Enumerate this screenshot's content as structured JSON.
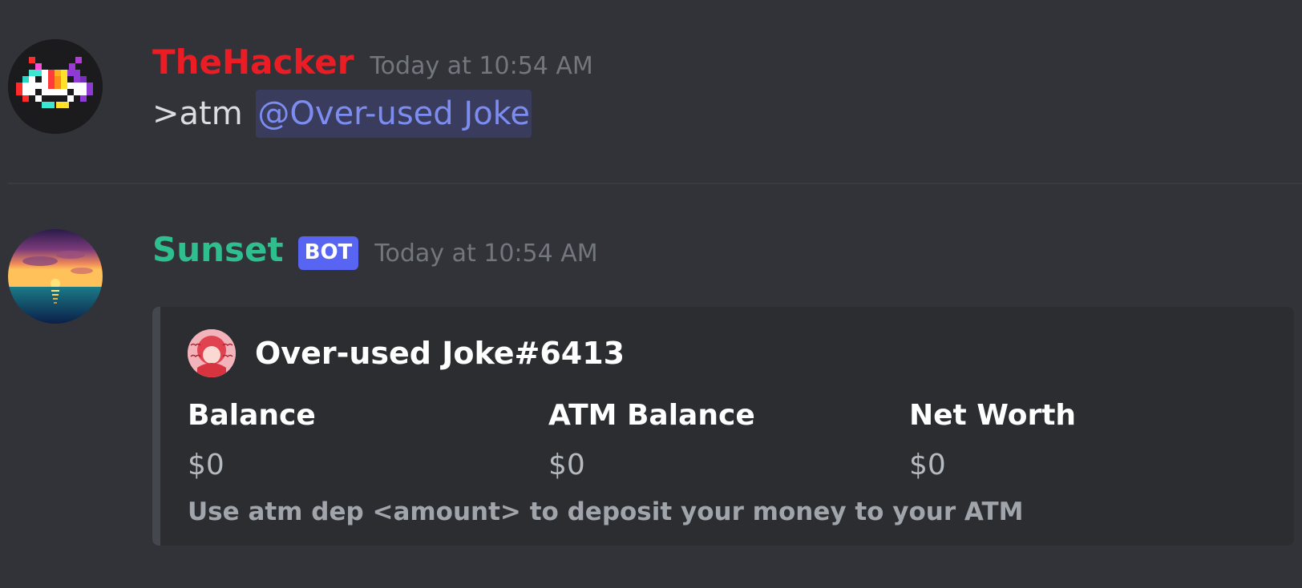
{
  "messages": [
    {
      "author": "TheHacker",
      "author_color": "#ec1c24",
      "timestamp": "Today at 10:54 AM",
      "content_prefix": ">atm",
      "mention": "@Over-used Joke",
      "avatar_icon": "pixel-space-invader-icon"
    },
    {
      "author": "Sunset",
      "author_color": "#2fbf8f",
      "bot_tag": "BOT",
      "timestamp": "Today at 10:54 AM",
      "avatar_icon": "sunset-avatar-icon",
      "embed": {
        "author": "Over-used Joke#6413",
        "author_avatar_icon": "anime-avatar-icon",
        "fields": [
          {
            "name": "Balance",
            "value": "$0"
          },
          {
            "name": "ATM Balance",
            "value": "$0"
          },
          {
            "name": "Net Worth",
            "value": "$0"
          }
        ],
        "footer": "Use atm dep <amount> to deposit your money to your ATM"
      }
    }
  ],
  "colors": {
    "background": "#313338",
    "embed_background": "#2b2d31",
    "mention": "#7c8cf0",
    "bot_tag": "#5865f2",
    "timestamp": "#72767d"
  }
}
